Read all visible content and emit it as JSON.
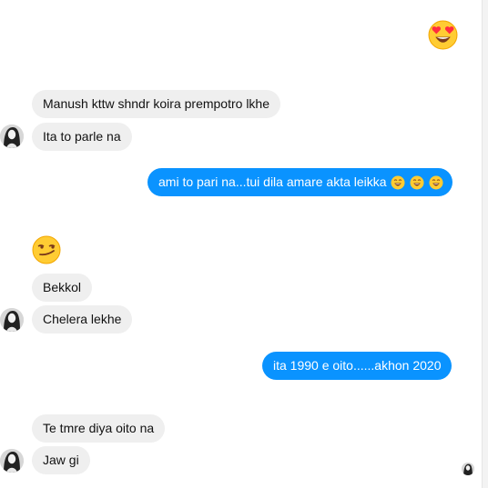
{
  "messages": {
    "m1": "Manush kttw shndr koira prempotro lkhe",
    "m2": "Ita to parle na",
    "m3": "ami to pari na...tui dila amare akta leikka",
    "m4": "Bekkol",
    "m5": "Chelera lekhe",
    "m6": "ita 1990 e oito......akhon 2020",
    "m7": "Te tmre diya oito na",
    "m8": "Jaw gi"
  },
  "emojis": {
    "heart_eyes": "heart-eyes-emoji",
    "smirk": "smirk-emoji",
    "grin": "grinning-sweat-emoji"
  },
  "colors": {
    "incoming_bubble": "#efefef",
    "outgoing_bubble": "#0a93ff",
    "emoji_yellow": "#ffcc33"
  }
}
